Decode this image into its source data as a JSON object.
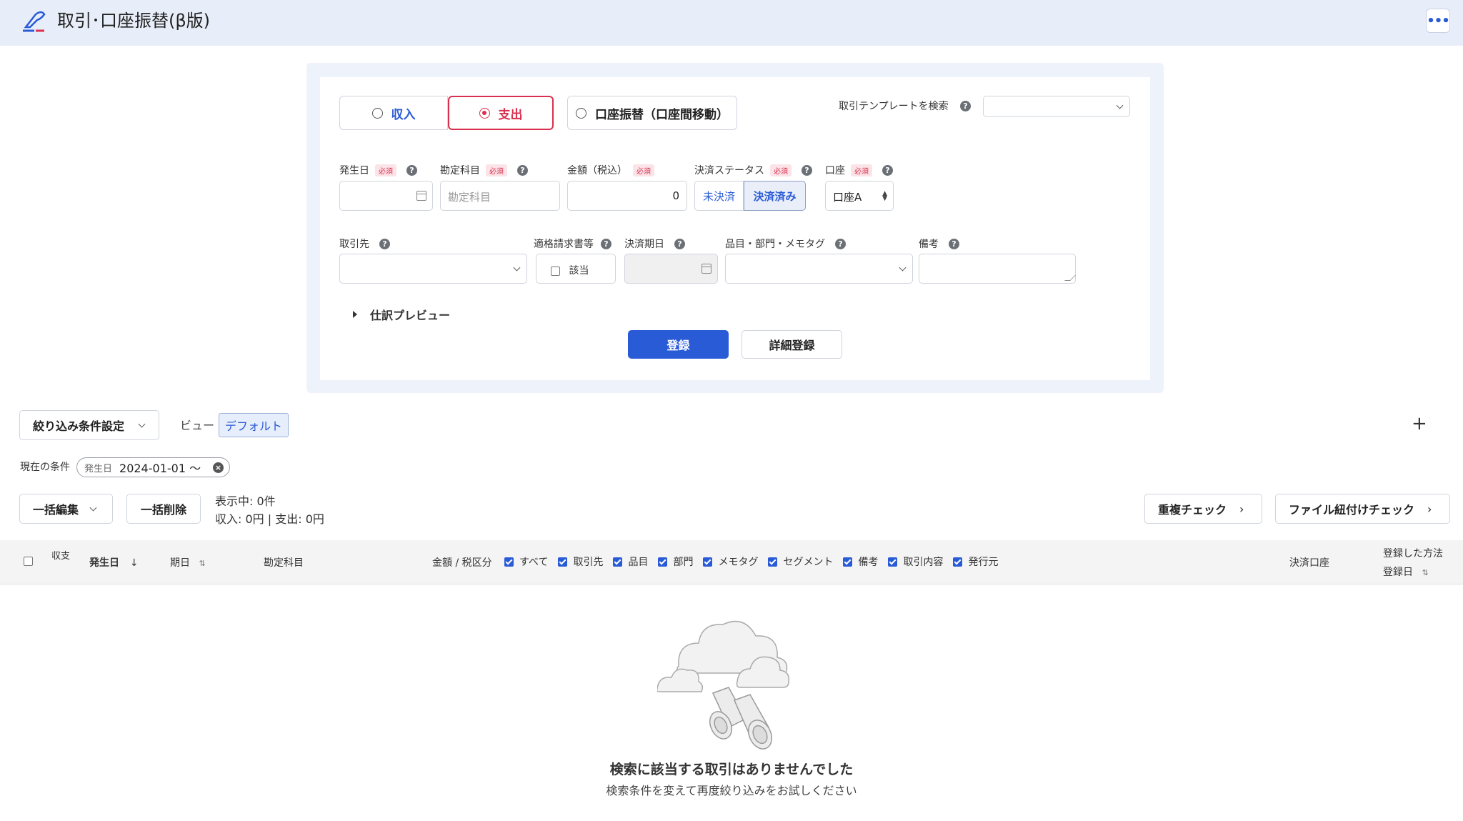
{
  "app": {
    "title": "取引･口座振替(β版)",
    "more_icon": "more-dots-icon"
  },
  "form": {
    "tabs": [
      {
        "label": "収入",
        "selected": false
      },
      {
        "label": "支出",
        "selected": true
      },
      {
        "label": "口座振替（口座間移動）",
        "selected": false
      }
    ],
    "template_search_label": "取引テンプレートを検索",
    "required_badge": "必須",
    "fields": {
      "date": {
        "label": "発生日"
      },
      "account_item": {
        "label": "勘定科目",
        "placeholder": "勘定科目"
      },
      "amount": {
        "label": "金額（税込）",
        "value": "0"
      },
      "settlement_status": {
        "label": "決済ステータス",
        "options": [
          "未決済",
          "決済済み"
        ],
        "selected": "決済済み"
      },
      "wallet": {
        "label": "口座",
        "value": "口座A"
      },
      "partner": {
        "label": "取引先"
      },
      "qualified_invoice": {
        "label": "適格請求書等",
        "checkbox_label": "該当",
        "checked": false
      },
      "due_date": {
        "label": "決済期日"
      },
      "tags": {
        "label": "品目・部門・メモタグ"
      },
      "memo": {
        "label": "備考"
      }
    },
    "preview_toggle": "仕訳プレビュー",
    "submit_button": "登録",
    "detail_button": "詳細登録"
  },
  "filters": {
    "settings_button": "絞り込み条件設定",
    "view_label": "ビュー",
    "view_chip": "デフォルト",
    "add_button": "+",
    "current_conditions_label": "現在の条件",
    "condition": {
      "key": "発生日",
      "value": "2024-01-01 〜"
    }
  },
  "actions": {
    "bulk_edit": "一括編集",
    "bulk_delete": "一括削除",
    "showing": "表示中: 0件",
    "summary": "収入: 0円 | 支出: 0円",
    "duplicate_check": "重複チェック",
    "file_link_check": "ファイル紐付けチェック"
  },
  "table": {
    "headers": {
      "type": "収支",
      "date": "発生日",
      "due": "期日",
      "account_item": "勘定科目",
      "amount_tax": "金額 / 税区分",
      "settlement_account": "決済口座",
      "registered_method": "登録した方法",
      "registered_date": "登録日"
    },
    "column_toggles": [
      "すべて",
      "取引先",
      "品目",
      "部門",
      "メモタグ",
      "セグメント",
      "備考",
      "取引内容",
      "発行元"
    ]
  },
  "empty": {
    "title": "検索に該当する取引はありませんでした",
    "subtitle": "検索条件を変えて再度絞り込みをお試しください"
  },
  "colors": {
    "primary": "#2a5bd7",
    "expense": "#d9304e",
    "header_bg": "#e8eef9"
  }
}
